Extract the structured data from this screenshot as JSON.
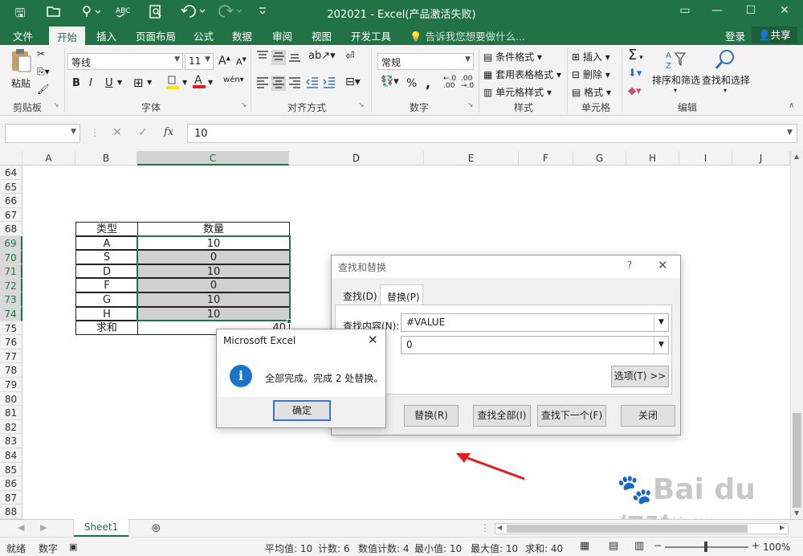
{
  "title_bar": {
    "title": "202021 - Excel(产品激活失败)",
    "save_glyph": "🖫",
    "open_glyph": "📂",
    "quick_icons": [
      "touch-mode-icon",
      "spelling-icon",
      "print-preview-icon",
      "undo-icon",
      "redo-icon",
      "customize-icon"
    ]
  },
  "ribbon_tabs": [
    "文件",
    "开始",
    "插入",
    "页面布局",
    "公式",
    "数据",
    "审阅",
    "视图",
    "开发工具"
  ],
  "tell_me": "告诉我您想要做什么...",
  "login": "登录",
  "share": "共享",
  "ribbon": {
    "clipboard": {
      "paste": "粘贴",
      "label": "剪贴板"
    },
    "font": {
      "name": "等线",
      "size": "11",
      "bold": "B",
      "italic": "I",
      "underline": "U",
      "grow": "A",
      "shrink": "A",
      "label": "字体"
    },
    "alignment": {
      "label": "对齐方式"
    },
    "number": {
      "format": "常规",
      "percent": "%",
      "comma": ",",
      "label": "数字"
    },
    "styles": {
      "conditional": "条件格式",
      "table": "套用表格格式",
      "cell": "单元格样式",
      "label": "样式"
    },
    "cells": {
      "insert": "插入",
      "delete": "删除",
      "format": "格式",
      "label": "单元格"
    },
    "editing": {
      "sum": "Σ",
      "sort": "排序和筛选",
      "find": "查找和选择",
      "label": "编辑"
    }
  },
  "formula_bar": {
    "name_box": "",
    "value": "10",
    "fx": "fx"
  },
  "columns": [
    "A",
    "B",
    "C",
    "D",
    "E",
    "F",
    "G",
    "H",
    "I",
    "J"
  ],
  "rows": [
    "64",
    "65",
    "66",
    "67",
    "68",
    "69",
    "70",
    "71",
    "72",
    "73",
    "74",
    "75",
    "76",
    "77",
    "78",
    "79",
    "80",
    "81",
    "82",
    "83",
    "84",
    "85",
    "86",
    "87",
    "88"
  ],
  "table": {
    "header": [
      "类型",
      "数量"
    ],
    "data": [
      [
        "A",
        "10"
      ],
      [
        "S",
        "0"
      ],
      [
        "D",
        "10"
      ],
      [
        "F",
        "0"
      ],
      [
        "G",
        "10"
      ],
      [
        "H",
        "10"
      ]
    ],
    "total_label": "求和",
    "total_value": "40"
  },
  "find_replace": {
    "title": "查找和替换",
    "help": "?",
    "tab_find": "查找(D)",
    "tab_replace": "替换(P)",
    "find_label": "查找内容(N):",
    "find_value": "#VALUE",
    "replace_value": "0",
    "options": "选项(T) >>",
    "btn_replace_all_tail": ")",
    "btn_replace": "替换(R)",
    "btn_find_all": "查找全部(I)",
    "btn_find_next": "查找下一个(F)",
    "btn_close": "关闭"
  },
  "msgbox": {
    "title": "Microsoft Excel",
    "message": "全部完成。完成 2 处替换。",
    "ok": "确定",
    "info_glyph": "i"
  },
  "sheet_tabs": [
    "Sheet1"
  ],
  "status": {
    "ready": "就绪",
    "mode": "数字",
    "average": "平均值: 10",
    "count": "计数: 6",
    "numcount": "数值计数: 4",
    "min": "最小值: 10",
    "max": "最大值: 10",
    "sum": "求和: 40",
    "zoom": "100%"
  },
  "watermark": "Bai du 经验",
  "watermark_url": "jingyan.baidu.com",
  "colors": {
    "excel_green": "#217346",
    "selection_fill": "#d0d0d0",
    "arrow_red": "#e0201a",
    "info_blue": "#1a74c8"
  }
}
